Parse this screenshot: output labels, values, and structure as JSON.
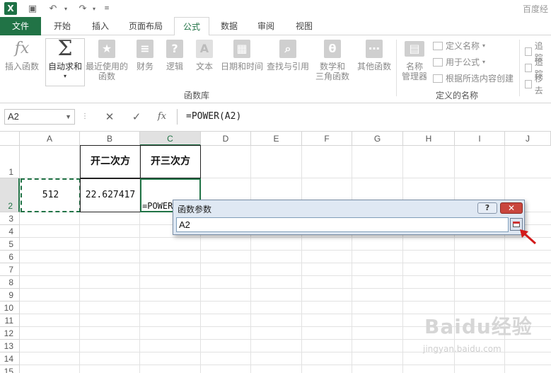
{
  "titlebar": {
    "right_text": "百度经"
  },
  "tabs": {
    "file": "文件",
    "home": "开始",
    "insert": "插入",
    "layout": "页面布局",
    "formulas": "公式",
    "data": "数据",
    "review": "审阅",
    "view": "视图"
  },
  "ribbon": {
    "insert_function": "插入函数",
    "autosum": "自动求和",
    "recent_1": "最近使用的",
    "recent_2": "函数",
    "financial": "财务",
    "logical": "逻辑",
    "text": "文本",
    "datetime": "日期和时间",
    "lookup": "查找与引用",
    "math_1": "数学和",
    "math_2": "三角函数",
    "more": "其他函数",
    "group_library": "函数库",
    "name_mgr_1": "名称",
    "name_mgr_2": "管理器",
    "define_name": "定义名称",
    "use_in_formula": "用于公式",
    "create_from_sel": "根据所选内容创建",
    "group_names": "定义的名称",
    "trace_1": "追踪",
    "trace_2": "追踪",
    "remove": "移去"
  },
  "formula_bar": {
    "name_box": "A2",
    "cancel": "✕",
    "enter": "✓",
    "fx": "fx",
    "formula": "=POWER(A2)"
  },
  "columns": [
    "A",
    "B",
    "C",
    "D",
    "E",
    "F",
    "G",
    "H",
    "I",
    "J"
  ],
  "rows": [
    "1",
    "2",
    "3",
    "4",
    "5",
    "6",
    "7",
    "8",
    "9",
    "10",
    "11",
    "12",
    "13",
    "14",
    "15"
  ],
  "cells": {
    "B1": "开二次方",
    "C1": "开三次方",
    "A2": "512",
    "B2": "22.627417",
    "C2": "=POWER"
  },
  "dialog": {
    "title": "函数参数",
    "help": "?",
    "close": "✕",
    "input": "A2"
  },
  "watermark": {
    "main": "Baidu经验",
    "sub": "jingyan.baidu.com"
  }
}
